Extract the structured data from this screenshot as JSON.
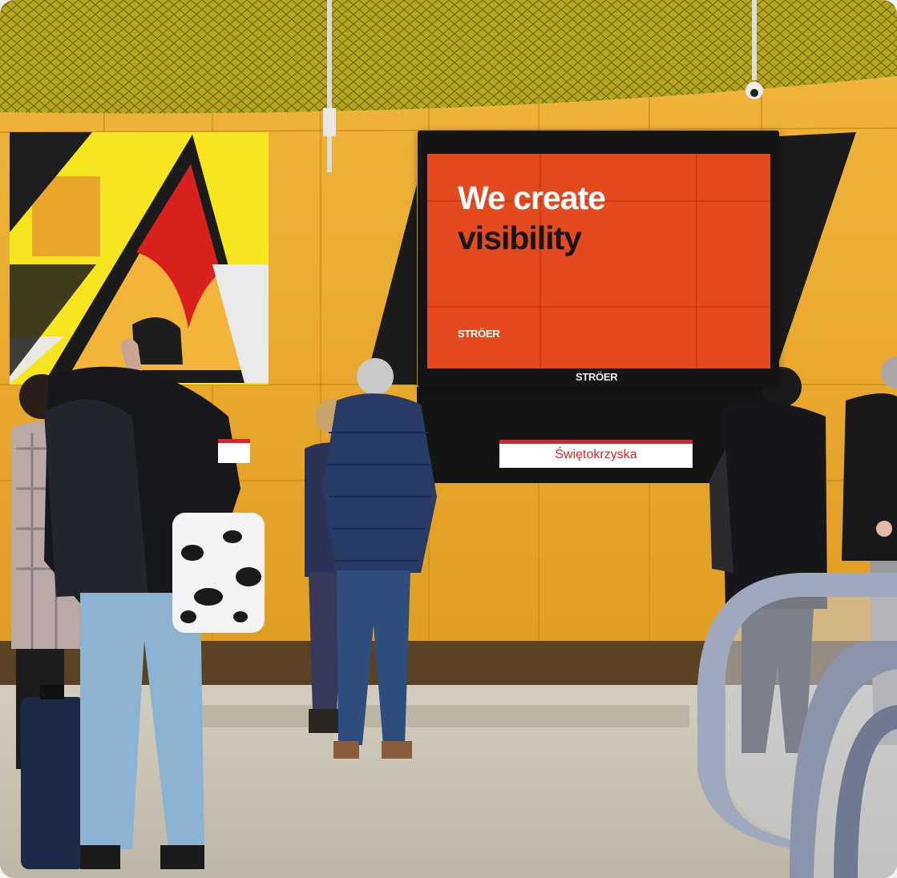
{
  "photo": {
    "subject": "metro-station-platform-with-digital-billboard"
  },
  "billboard": {
    "headline_line1": "We create",
    "headline_line2": "visibility",
    "screen_logo": "STRÖER",
    "bezel_logo": "STRÖER",
    "screen_color": "#e34a20"
  },
  "station_sign": {
    "name": "Świętokrzyska",
    "accent_color": "#d8232a"
  },
  "colors": {
    "wall_yellow": "#e9a92a",
    "ceiling": "#b3a41c"
  }
}
